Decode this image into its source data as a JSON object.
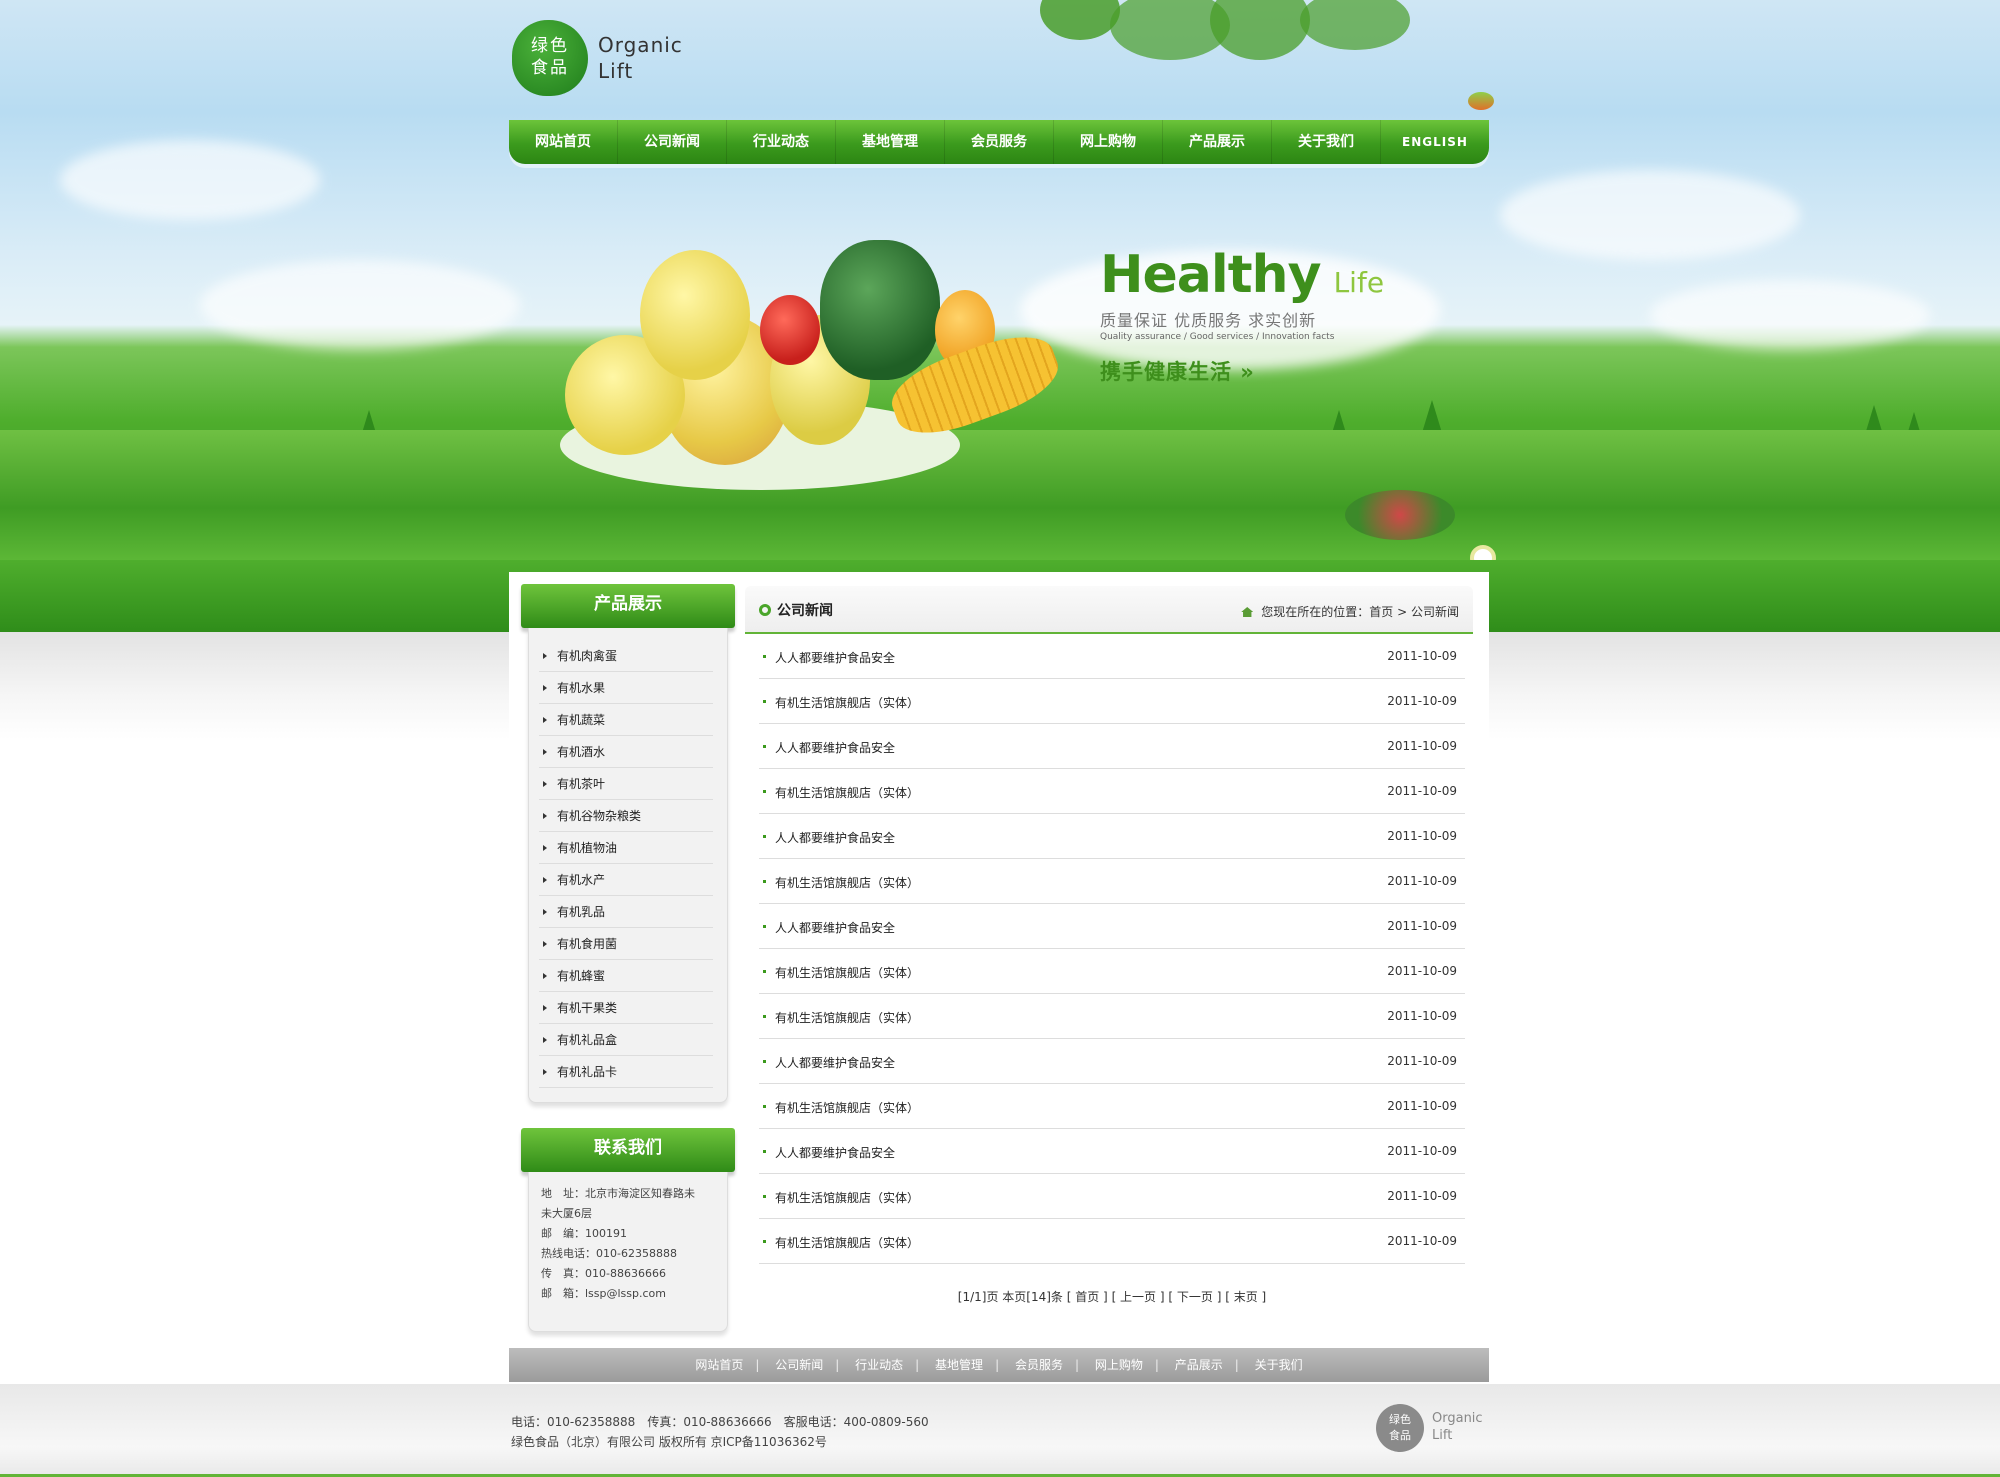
{
  "logo": {
    "badge_line1": "绿色",
    "badge_line2": "食品",
    "word_line1": "Organic",
    "word_line2": "Lift"
  },
  "nav": [
    {
      "label": "网站首页"
    },
    {
      "label": "公司新闻"
    },
    {
      "label": "行业动态"
    },
    {
      "label": "基地管理"
    },
    {
      "label": "会员服务"
    },
    {
      "label": "网上购物"
    },
    {
      "label": "产品展示"
    },
    {
      "label": "关于我们"
    },
    {
      "label": "ENGLISH"
    }
  ],
  "banner": {
    "healthy": "Healthy",
    "life": "Life",
    "cn_subtitle": "质量保证 优质服务 求实创新",
    "en_subtitle": "Quality assurance / Good services / Innovation facts",
    "slogan": "携手健康生活 »"
  },
  "sidebar": {
    "products_title": "产品展示",
    "categories": [
      "有机肉禽蛋",
      "有机水果",
      "有机蔬菜",
      "有机酒水",
      "有机茶叶",
      "有机谷物杂粮类",
      "有机植物油",
      "有机水产",
      "有机乳品",
      "有机食用菌",
      "有机蜂蜜",
      "有机干果类",
      "有机礼品盒",
      "有机礼品卡"
    ],
    "contact_title": "联系我们",
    "contact": {
      "address_1": "地　址：北京市海淀区知春路未",
      "address_2": "未大厦6层",
      "zip": "邮　编：100191",
      "hotline": "热线电话：010-62358888",
      "fax": "传　真：010-88636666",
      "email": "邮　箱：lssp@lssp.com"
    }
  },
  "main": {
    "title": "公司新闻",
    "breadcrumb_prefix": "您现在所在的位置：",
    "breadcrumb_home": "首页",
    "breadcrumb_sep": ">",
    "breadcrumb_current": "公司新闻",
    "news": [
      {
        "title": "人人都要维护食品安全",
        "date": "2011-10-09"
      },
      {
        "title": "有机生活馆旗舰店（实体）",
        "date": "2011-10-09"
      },
      {
        "title": "人人都要维护食品安全",
        "date": "2011-10-09"
      },
      {
        "title": "有机生活馆旗舰店（实体）",
        "date": "2011-10-09"
      },
      {
        "title": "人人都要维护食品安全",
        "date": "2011-10-09"
      },
      {
        "title": "有机生活馆旗舰店（实体）",
        "date": "2011-10-09"
      },
      {
        "title": "人人都要维护食品安全",
        "date": "2011-10-09"
      },
      {
        "title": "有机生活馆旗舰店（实体）",
        "date": "2011-10-09"
      },
      {
        "title": "有机生活馆旗舰店（实体）",
        "date": "2011-10-09"
      },
      {
        "title": "人人都要维护食品安全",
        "date": "2011-10-09"
      },
      {
        "title": "有机生活馆旗舰店（实体）",
        "date": "2011-10-09"
      },
      {
        "title": "人人都要维护食品安全",
        "date": "2011-10-09"
      },
      {
        "title": "有机生活馆旗舰店（实体）",
        "date": "2011-10-09"
      },
      {
        "title": "有机生活馆旗舰店（实体）",
        "date": "2011-10-09"
      }
    ],
    "pager": {
      "info": "[1/1]页 本页[14]条",
      "first": "[ 首页 ]",
      "prev": "[ 上一页 ]",
      "next": "[ 下一页 ]",
      "last": "[ 末页 ]"
    }
  },
  "footer_nav": [
    "网站首页",
    "公司新闻",
    "行业动态",
    "基地管理",
    "会员服务",
    "网上购物",
    "产品展示",
    "关于我们"
  ],
  "footer": {
    "line1": "电话：010-62358888　传真：010-88636666　客服电话：400-0809-560",
    "line2": "绿色食品（北京）有限公司 版权所有 京ICP备11036362号",
    "logo_badge_1": "绿色",
    "logo_badge_2": "食品",
    "logo_word_1": "Organic",
    "logo_word_2": "Lift"
  },
  "colors": {
    "brand_green": "#3b9a1d",
    "accent_green": "#62b437",
    "footer_grey": "#9b9b9b"
  }
}
